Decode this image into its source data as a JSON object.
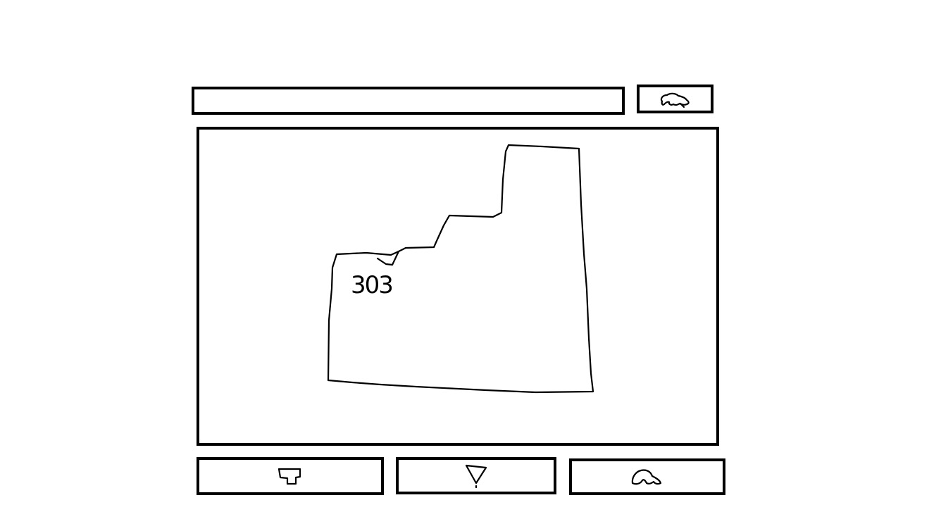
{
  "search": {
    "value": "",
    "placeholder": ""
  },
  "toolbar": {
    "top_button_icon": "cloud-hand-icon"
  },
  "canvas": {
    "room_label": "303",
    "shape": "floor-plan-outline"
  },
  "bottom_bar": {
    "left_button_icon": "tooth-icon",
    "middle_button_icon": "funnel-icon",
    "right_button_icon": "hand-icon"
  },
  "colors": {
    "stroke": "#000000",
    "background": "#ffffff"
  }
}
